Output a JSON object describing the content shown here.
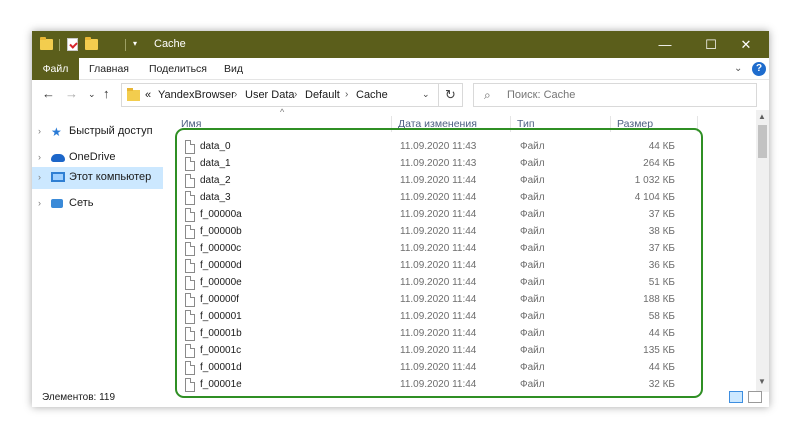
{
  "window": {
    "title": "Cache",
    "min_label": "—",
    "max_label": "☐",
    "close_label": "✕"
  },
  "ribbon": {
    "file_tab": "Файл",
    "tabs": [
      "Главная",
      "Поделиться",
      "Вид"
    ],
    "expand_label": "⌄",
    "help_label": "?"
  },
  "nav": {
    "back_label": "←",
    "forward_label": "→",
    "recent_label": "⌄",
    "up_label": "↑",
    "breadcrumb_prefix": "«",
    "breadcrumb": [
      "YandexBrowser",
      "User Data",
      "Default",
      "Cache"
    ],
    "crumb_separator": "›",
    "dropdown_label": "⌄",
    "refresh_label": "↻",
    "search_icon": "⌕",
    "search_placeholder": "Поиск: Cache"
  },
  "sidebar": {
    "items": [
      {
        "label": "Быстрый доступ",
        "icon": "star-icon",
        "arrow": "›"
      },
      {
        "label": "OneDrive",
        "icon": "cloud-icon",
        "arrow": "›"
      },
      {
        "label": "Этот компьютер",
        "icon": "computer-icon",
        "arrow": "›"
      },
      {
        "label": "Сеть",
        "icon": "network-icon",
        "arrow": "›"
      }
    ]
  },
  "columns": {
    "sort_indicator": "^",
    "name": "Имя",
    "date": "Дата изменения",
    "type": "Тип",
    "size": "Размер"
  },
  "files": [
    {
      "name": "data_0",
      "date": "11.09.2020 11:43",
      "type": "Файл",
      "size": "44 КБ"
    },
    {
      "name": "data_1",
      "date": "11.09.2020 11:43",
      "type": "Файл",
      "size": "264 КБ"
    },
    {
      "name": "data_2",
      "date": "11.09.2020 11:44",
      "type": "Файл",
      "size": "1 032 КБ"
    },
    {
      "name": "data_3",
      "date": "11.09.2020 11:44",
      "type": "Файл",
      "size": "4 104 КБ"
    },
    {
      "name": "f_00000a",
      "date": "11.09.2020 11:44",
      "type": "Файл",
      "size": "37 КБ"
    },
    {
      "name": "f_00000b",
      "date": "11.09.2020 11:44",
      "type": "Файл",
      "size": "38 КБ"
    },
    {
      "name": "f_00000c",
      "date": "11.09.2020 11:44",
      "type": "Файл",
      "size": "37 КБ"
    },
    {
      "name": "f_00000d",
      "date": "11.09.2020 11:44",
      "type": "Файл",
      "size": "36 КБ"
    },
    {
      "name": "f_00000e",
      "date": "11.09.2020 11:44",
      "type": "Файл",
      "size": "51 КБ"
    },
    {
      "name": "f_00000f",
      "date": "11.09.2020 11:44",
      "type": "Файл",
      "size": "188 КБ"
    },
    {
      "name": "f_000001",
      "date": "11.09.2020 11:44",
      "type": "Файл",
      "size": "58 КБ"
    },
    {
      "name": "f_00001b",
      "date": "11.09.2020 11:44",
      "type": "Файл",
      "size": "44 КБ"
    },
    {
      "name": "f_00001c",
      "date": "11.09.2020 11:44",
      "type": "Файл",
      "size": "135 КБ"
    },
    {
      "name": "f_00001d",
      "date": "11.09.2020 11:44",
      "type": "Файл",
      "size": "44 КБ"
    },
    {
      "name": "f_00001e",
      "date": "11.09.2020 11:44",
      "type": "Файл",
      "size": "32 КБ"
    }
  ],
  "status": {
    "items_text": "Элементов: 119"
  },
  "scrollbar": {
    "up_label": "▲",
    "down_label": "▼"
  },
  "colors": {
    "titlebar": "#5b5e1b",
    "selection": "#cce8ff",
    "highlight": "#2f8f24",
    "accent": "#1e6ccd"
  }
}
